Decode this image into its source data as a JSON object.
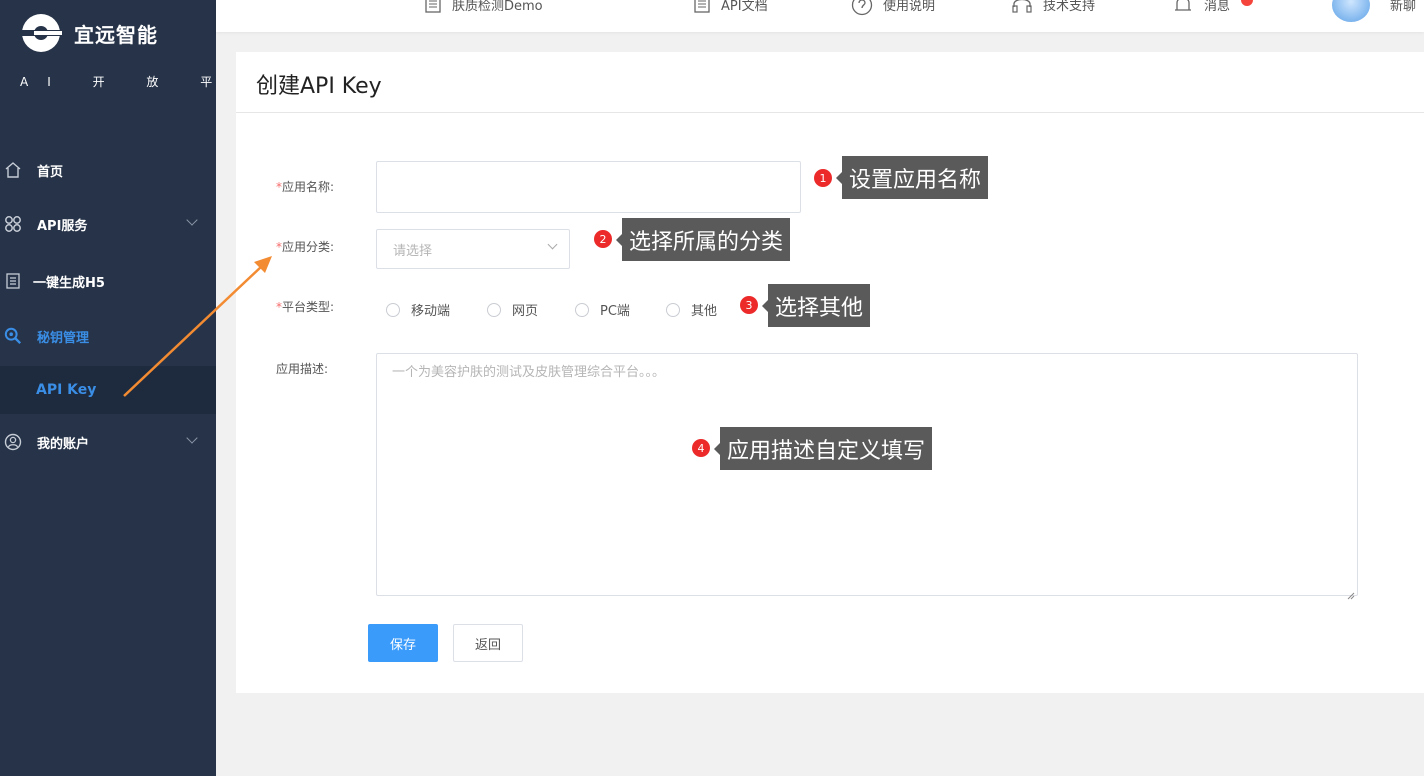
{
  "brand": {
    "name": "宜远智能",
    "subtitle": "AI 开 放 平 台"
  },
  "sidebar": {
    "items": [
      {
        "label": "首页",
        "icon": "home-icon"
      },
      {
        "label": "API服务",
        "icon": "grid-icon"
      },
      {
        "label": "一键生成H5",
        "icon": "document-icon"
      },
      {
        "label": "秘钥管理",
        "icon": "key-search-icon"
      },
      {
        "label": "我的账户",
        "icon": "user-icon"
      }
    ],
    "sub_item": {
      "label": "API Key"
    }
  },
  "topbar": {
    "links": [
      {
        "label": "肤质检测Demo",
        "icon": "document-icon"
      },
      {
        "label": "API文档",
        "icon": "document-icon"
      },
      {
        "label": "使用说明",
        "icon": "help-icon"
      },
      {
        "label": "技术支持",
        "icon": "headset-icon"
      },
      {
        "label": "消息",
        "icon": "bell-icon"
      }
    ],
    "user_name": "新聊"
  },
  "page": {
    "title": "创建API Key",
    "form": {
      "required_mark": "*",
      "name_label": "应用名称:",
      "name_value": "",
      "category_label": "应用分类:",
      "category_placeholder": "请选择",
      "platform_label": "平台类型:",
      "platform_options": [
        "移动端",
        "网页",
        "PC端",
        "其他"
      ],
      "description_label": "应用描述:",
      "description_placeholder": "一个为美容护肤的测试及皮肤管理综合平台。。。"
    },
    "buttons": {
      "save": "保存",
      "back": "返回"
    }
  },
  "annotations": [
    {
      "num": "1",
      "text": "设置应用名称"
    },
    {
      "num": "2",
      "text": "选择所属的分类"
    },
    {
      "num": "3",
      "text": "选择其他"
    },
    {
      "num": "4",
      "text": "应用描述自定义填写"
    }
  ],
  "colors": {
    "sidebar_bg": "#263348",
    "accent": "#3a9bfa",
    "annotation_arrow": "#f28b32",
    "required": "#f56c6c"
  }
}
